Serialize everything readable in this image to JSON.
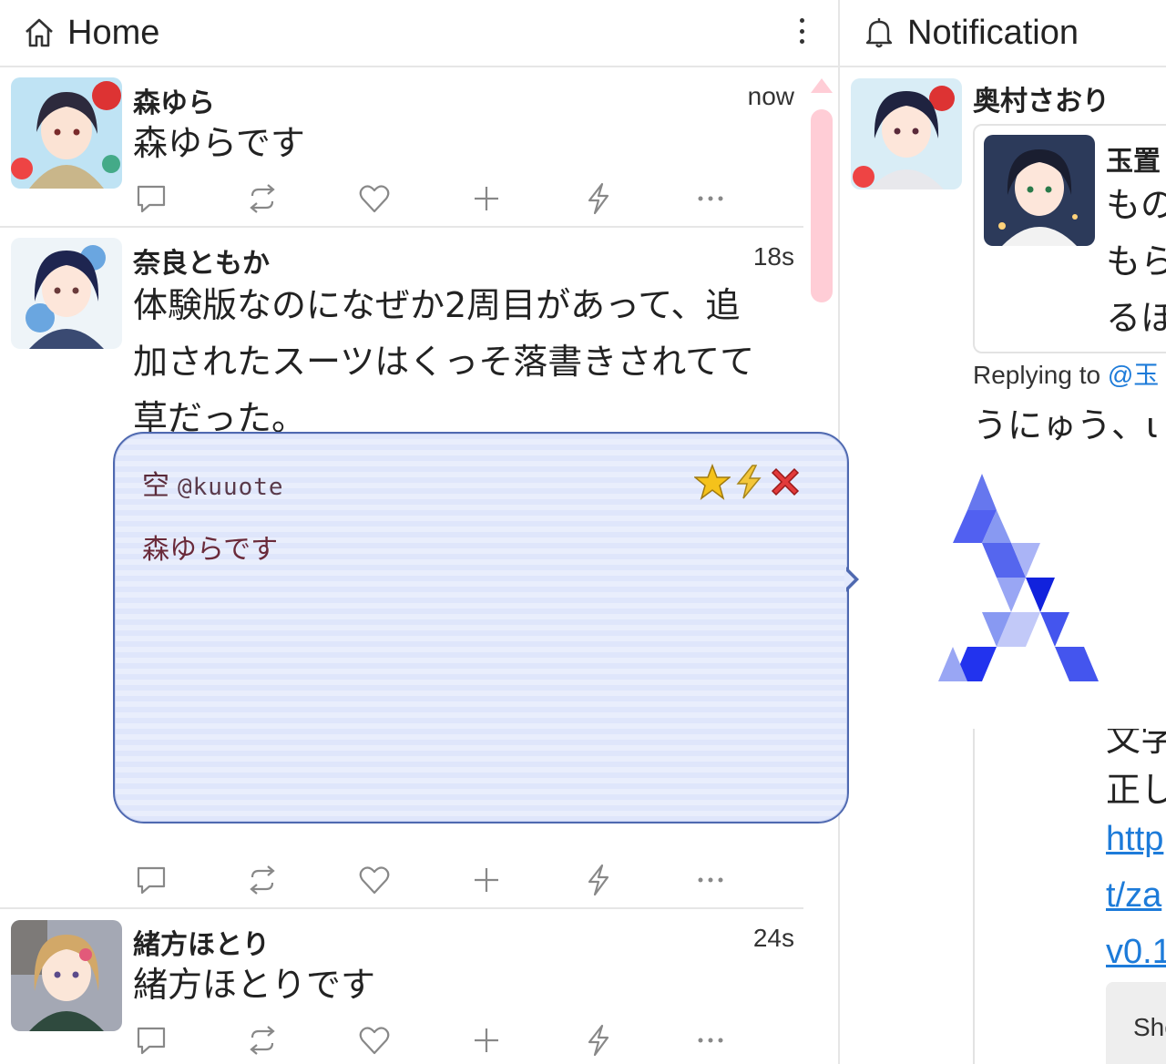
{
  "home_column": {
    "title": "Home",
    "icon": "home-icon",
    "menu_icon": "more-vertical-icon"
  },
  "notification_column": {
    "title": "Notification",
    "icon": "bell-icon"
  },
  "notes": [
    {
      "name": "森ゆら",
      "time": "now",
      "text": "森ゆらです"
    },
    {
      "name": "奈良ともか",
      "time": "18s",
      "text": "体験版なのになぜか2周目があって、追加されたスーツはくっそ落書きされてて草だった。"
    },
    {
      "name": "緒方ほとり",
      "time": "24s",
      "text": "緒方ほとりです"
    }
  ],
  "action_icons": [
    "reply-icon",
    "renote-icon",
    "like-icon",
    "add-reaction-icon",
    "boost-icon",
    "more-icon"
  ],
  "notification": {
    "name": "奥村さおり",
    "quote": {
      "name": "玉置",
      "lines": [
        "もの",
        "もら",
        "るほ"
      ]
    },
    "replying_label": "Replying to",
    "replying_handle": "@玉",
    "text": "うにゅう、ι",
    "lower_lines": [
      "文字",
      "正し"
    ],
    "links": [
      "http",
      "t/za",
      "v0.1"
    ],
    "show_button": "Sho"
  },
  "popup": {
    "kanji": "空",
    "handle": "@kuuote",
    "text": "森ゆらです",
    "icons": [
      "star-icon",
      "lightning-icon",
      "close-icon"
    ]
  },
  "colors": {
    "scrollbar": "#ffcdd6",
    "popup_border": "#4f69b0",
    "popup_bg": "#dfe6fb",
    "link": "#1d7bd9",
    "logo": "#3344ee"
  }
}
